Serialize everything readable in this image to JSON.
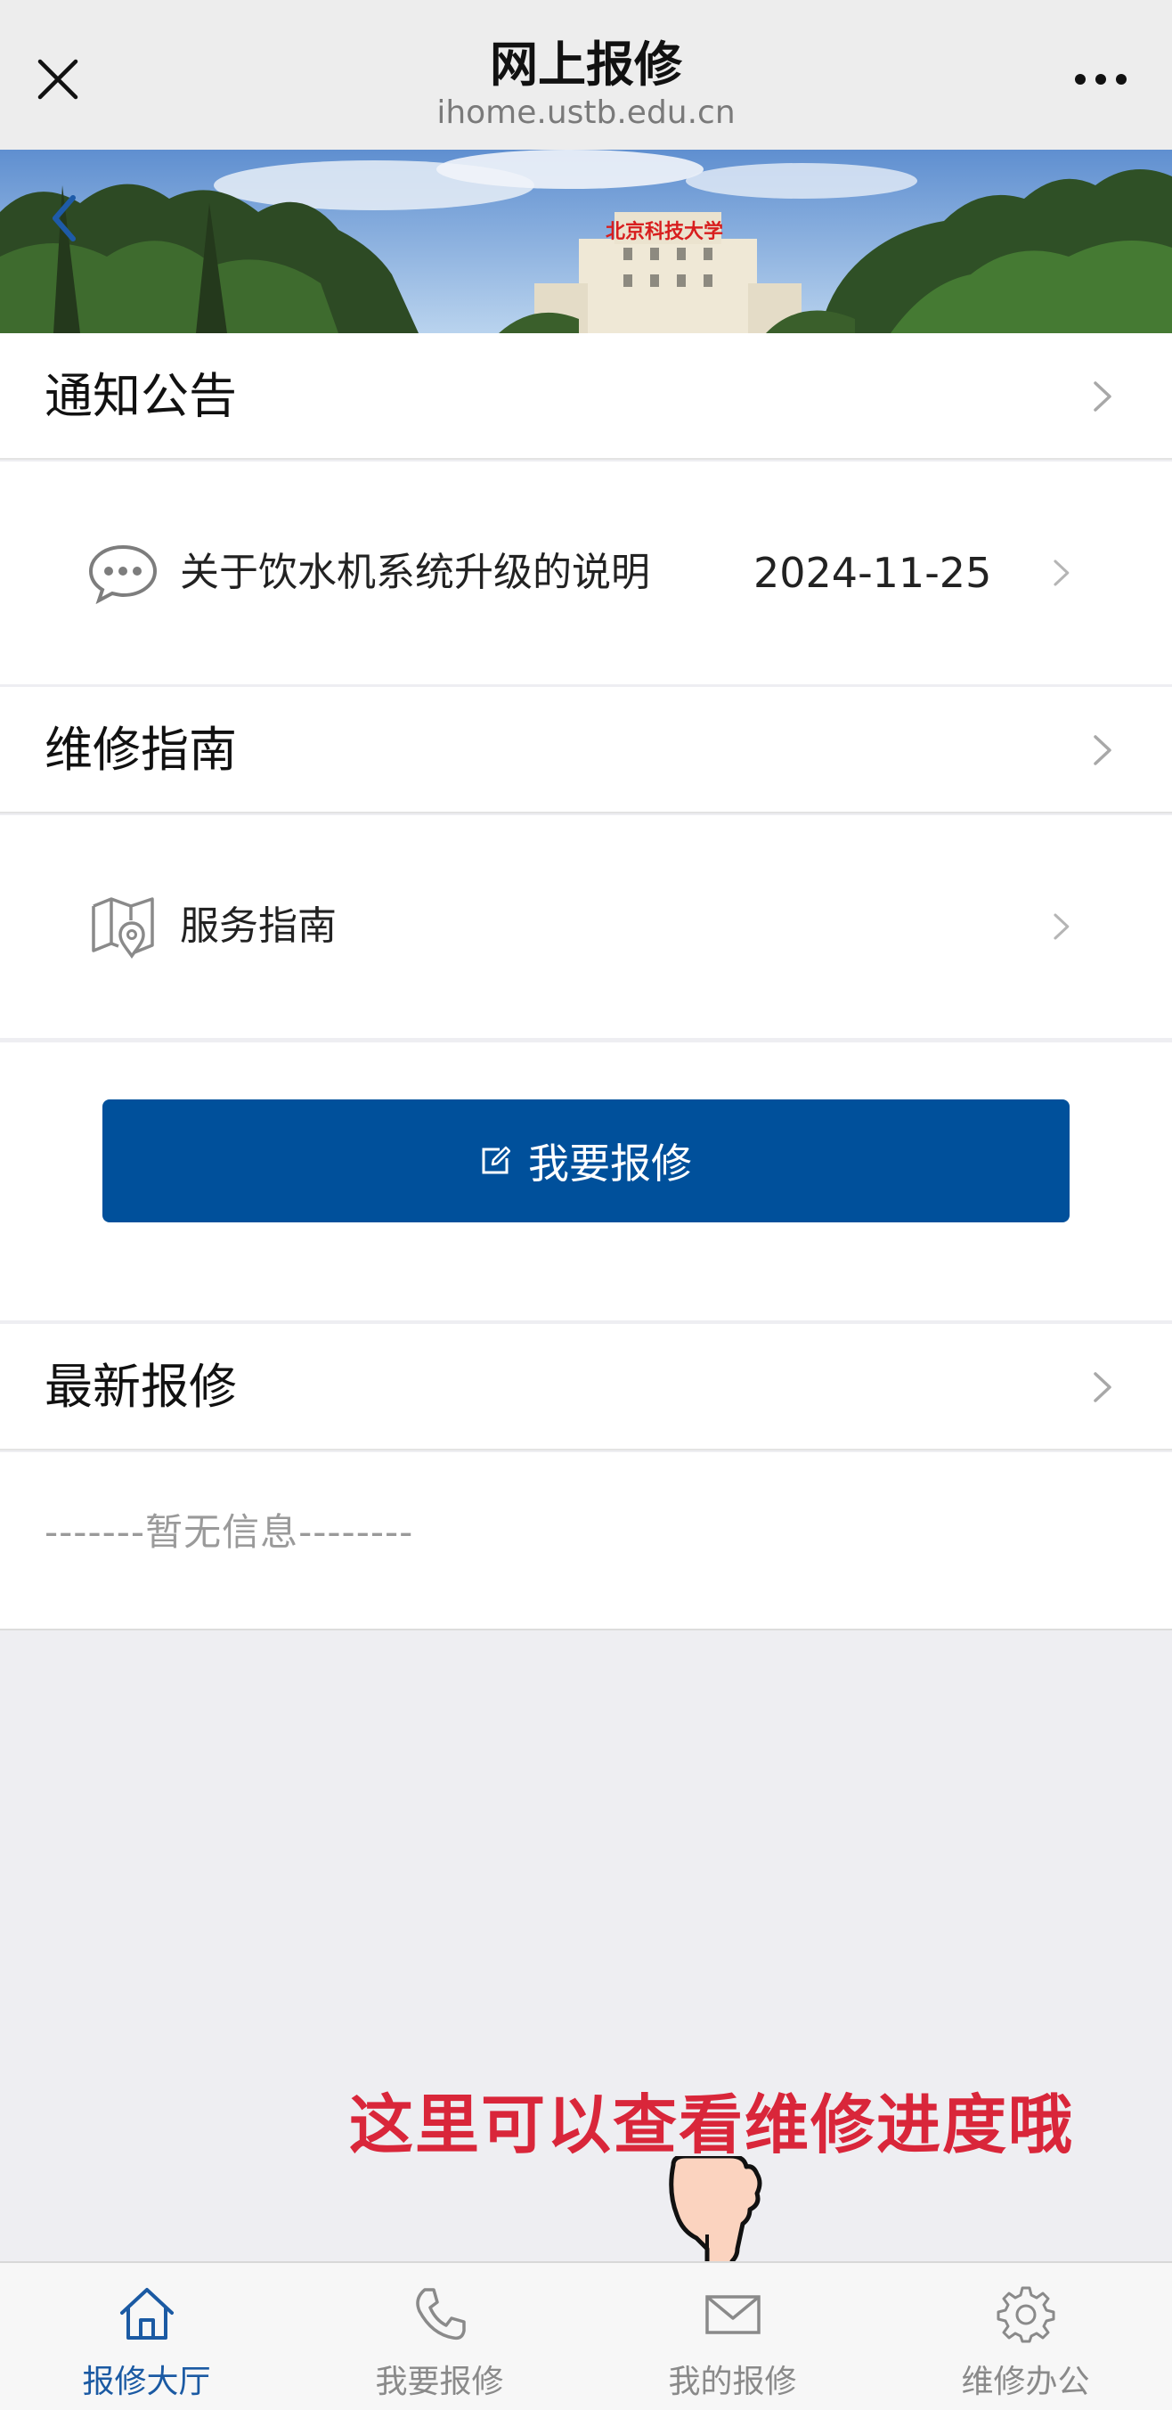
{
  "topbar": {
    "title": "网上报修",
    "domain": "ihome.ustb.edu.cn",
    "close_icon": "close-icon",
    "more_icon": "more-horizontal-icon"
  },
  "banner": {
    "caption": "北京科技大学",
    "back_icon": "chevron-left-icon"
  },
  "notice": {
    "heading": "通知公告",
    "items": [
      {
        "icon": "chat-bubble-icon",
        "title": "关于饮水机系统升级的说明",
        "date": "2024-11-25"
      }
    ]
  },
  "guide": {
    "heading": "维修指南",
    "items": [
      {
        "icon": "map-pin-icon",
        "title": "服务指南"
      }
    ]
  },
  "report_button": {
    "label": "我要报修",
    "icon": "edit-icon"
  },
  "latest": {
    "heading": "最新报修",
    "empty_text": "-------暂无信息--------"
  },
  "annotation": {
    "text": "这里可以查看维修进度哦",
    "pointer_icon": "pointing-hand-icon"
  },
  "tabs": [
    {
      "label": "报修大厅",
      "icon": "home-icon",
      "active": true
    },
    {
      "label": "我要报修",
      "icon": "phone-icon",
      "active": false
    },
    {
      "label": "我的报修",
      "icon": "mail-icon",
      "active": false
    },
    {
      "label": "维修办公",
      "icon": "gear-icon",
      "active": false
    }
  ],
  "colors": {
    "primary": "#00509b",
    "active_tab": "#1b5aa3",
    "annotation": "#d9263a",
    "page_bg": "#eeeef2"
  }
}
